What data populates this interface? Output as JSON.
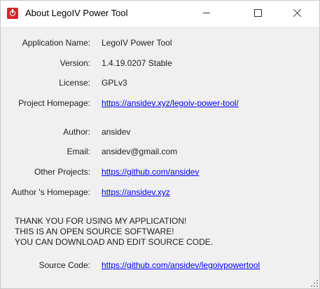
{
  "window": {
    "title": "About LegoIV Power Tool"
  },
  "fields": {
    "app_name_label": "Application Name:",
    "app_name_value": "LegoIV Power Tool",
    "version_label": "Version:",
    "version_value": "1.4.19.0207 Stable",
    "license_label": "License:",
    "license_value": "GPLv3",
    "homepage_label": "Project Homepage:",
    "homepage_value": "https://ansidev.xyz/legoiv-power-tool/",
    "author_label": "Author:",
    "author_value": "ansidev",
    "email_label": "Email:",
    "email_value": "ansidev@gmail.com",
    "other_projects_label": "Other Projects:",
    "other_projects_value": "https://github.com/ansidev",
    "author_homepage_label": "Author 's Homepage:",
    "author_homepage_value": "https://ansidev.xyz",
    "source_code_label": "Source Code:",
    "source_code_value": "https://github.com/ansidev/legoivpowertool"
  },
  "notice": {
    "line1": "THANK YOU FOR USING MY APPLICATION!",
    "line2": "THIS IS AN OPEN SOURCE SOFTWARE!",
    "line3": "YOU CAN DOWNLOAD AND EDIT SOURCE CODE."
  },
  "icons": {
    "app": "legoiv-app-icon",
    "minimize": "minimize-icon",
    "maximize": "maximize-icon",
    "close": "close-icon"
  },
  "colors": {
    "link": "#0000ff",
    "app_icon": "#d9232d",
    "background": "#f0f0f0"
  }
}
